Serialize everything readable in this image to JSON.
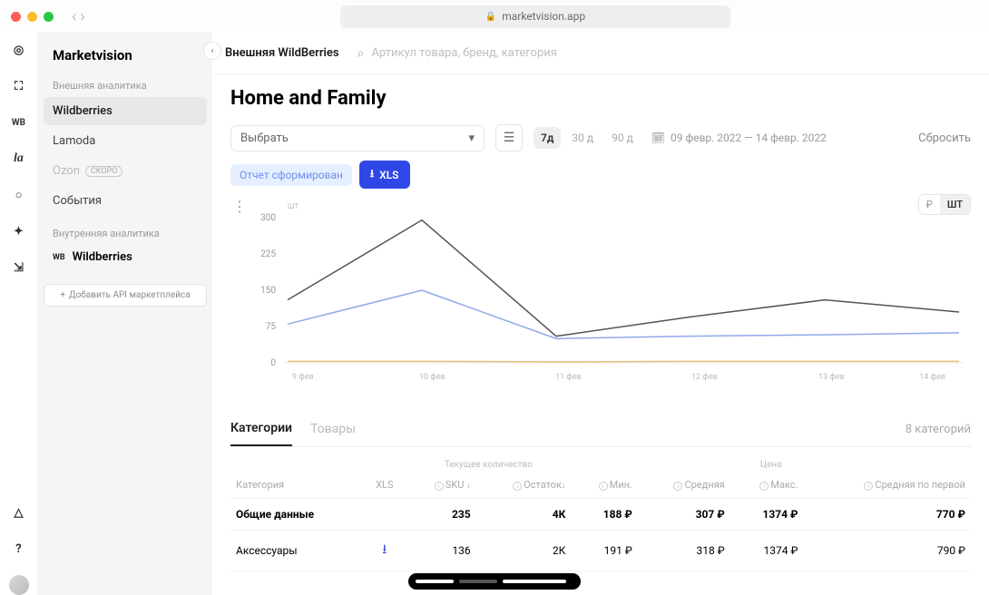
{
  "browser": {
    "url": "marketvision.app"
  },
  "brand": "Marketvision",
  "sidebar": {
    "section_external": "Внешняя аналитика",
    "items": [
      {
        "label": "Wildberries",
        "active": true
      },
      {
        "label": "Lamoda"
      },
      {
        "label": "Ozon",
        "soon": "СКОРО"
      },
      {
        "label": "События"
      }
    ],
    "section_internal": "Внутренняя аналитика",
    "internal_prefix": "WB",
    "internal_item": "Wildberries",
    "add_api": "Добавить API маркетплейса"
  },
  "topbar": {
    "crumb": "Внешняя WildBerries",
    "search_placeholder": "Артикул товара, бренд, категория"
  },
  "page": {
    "title": "Home and Family"
  },
  "filters": {
    "select_label": "Выбрать",
    "periods": [
      "7д",
      "30 д",
      "90 д"
    ],
    "active_period": "7д",
    "date_range": "09 февр. 2022 — 14 февр. 2022",
    "reset": "Сбросить"
  },
  "report": {
    "status": "Отчет сформирован",
    "xls": "XLS"
  },
  "units": {
    "ruble": "₽",
    "pieces": "ШТ",
    "active": "ШТ"
  },
  "chart_data": {
    "type": "line",
    "ylabel": "ШТ",
    "ylim": [
      0,
      300
    ],
    "y_ticks": [
      0,
      75,
      150,
      225,
      300
    ],
    "categories": [
      "9 фев",
      "10 фев",
      "11 фев",
      "12 фев",
      "13 фев",
      "14 фев"
    ],
    "series": [
      {
        "name": "series-dark",
        "color": "#555",
        "values": [
          130,
          295,
          55,
          95,
          130,
          105
        ]
      },
      {
        "name": "series-blue",
        "color": "#8fa8e6",
        "values": [
          80,
          150,
          50,
          55,
          58,
          62
        ]
      },
      {
        "name": "series-orange",
        "color": "#e8c079",
        "values": [
          3,
          3,
          2,
          3,
          3,
          3
        ]
      }
    ]
  },
  "tabs": {
    "categories": "Категории",
    "products": "Товары",
    "count_label": "8 категорий"
  },
  "table": {
    "group_qty": "Текущее количество",
    "group_price": "Цена",
    "columns": {
      "category": "Категория",
      "xls": "XLS",
      "sku": "SKU",
      "stock": "Остаток",
      "min": "Мин.",
      "avg": "Средняя",
      "max": "Макс.",
      "avg_first": "Средняя по первой"
    },
    "rows": [
      {
        "category": "Общие данные",
        "bold": true,
        "xls": "",
        "sku": "235",
        "stock": "4К",
        "min": "188 ₽",
        "avg": "307 ₽",
        "max": "1374 ₽",
        "avg_first": "770 ₽"
      },
      {
        "category": "Аксессуары",
        "xls": "dl",
        "sku": "136",
        "stock": "2К",
        "min": "191 ₽",
        "avg": "318 ₽",
        "max": "1374 ₽",
        "avg_first": "790 ₽"
      }
    ]
  }
}
